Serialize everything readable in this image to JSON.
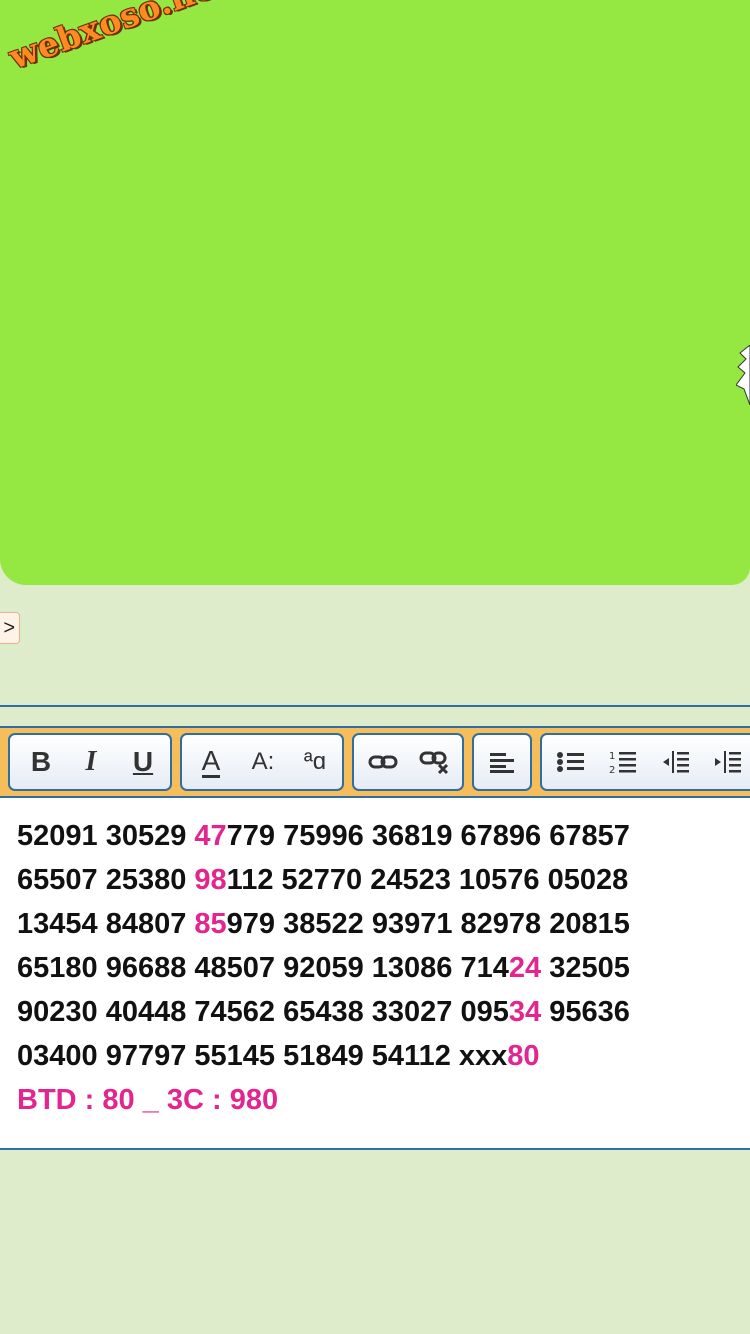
{
  "watermark": "webxoso.net",
  "nav": {
    "arrow_label": ">"
  },
  "toolbar": {
    "bold_label": "B",
    "italic_label": "I",
    "underline_label": "U",
    "font_color_label": "A",
    "font_size_label": "A:",
    "font_case_label": "ªɑ"
  },
  "editor": {
    "lines": [
      [
        {
          "t": "52091 30529 "
        },
        {
          "t": "47",
          "hl": true
        },
        {
          "t": "779 75996 36819 67896 67857"
        }
      ],
      [
        {
          "t": "65507 25380 "
        },
        {
          "t": "98",
          "hl": true
        },
        {
          "t": "112 52770 24523 10576 05028"
        }
      ],
      [
        {
          "t": "13454 84807 "
        },
        {
          "t": "85",
          "hl": true
        },
        {
          "t": "979 38522 93971 82978 20815"
        }
      ],
      [
        {
          "t": "65180 96688 48507 92059 13086 714"
        },
        {
          "t": "24",
          "hl": true
        },
        {
          "t": " 32505"
        }
      ],
      [
        {
          "t": "90230 40448 74562 65438 33027 095"
        },
        {
          "t": "34",
          "hl": true
        },
        {
          "t": " 95636"
        }
      ],
      [
        {
          "t": "03400 97797 55145 51849 54112 xxx"
        },
        {
          "t": "80",
          "hl": true
        }
      ],
      [
        {
          "t": "BTD : 80 _ 3C : 980",
          "hl": true
        }
      ]
    ]
  },
  "colors": {
    "banner_bg": "#95e841",
    "page_bg": "#dfeccc",
    "toolbar_bg": "#f6bd5b",
    "highlight": "#e3258f",
    "border_blue": "#2f6da3"
  }
}
